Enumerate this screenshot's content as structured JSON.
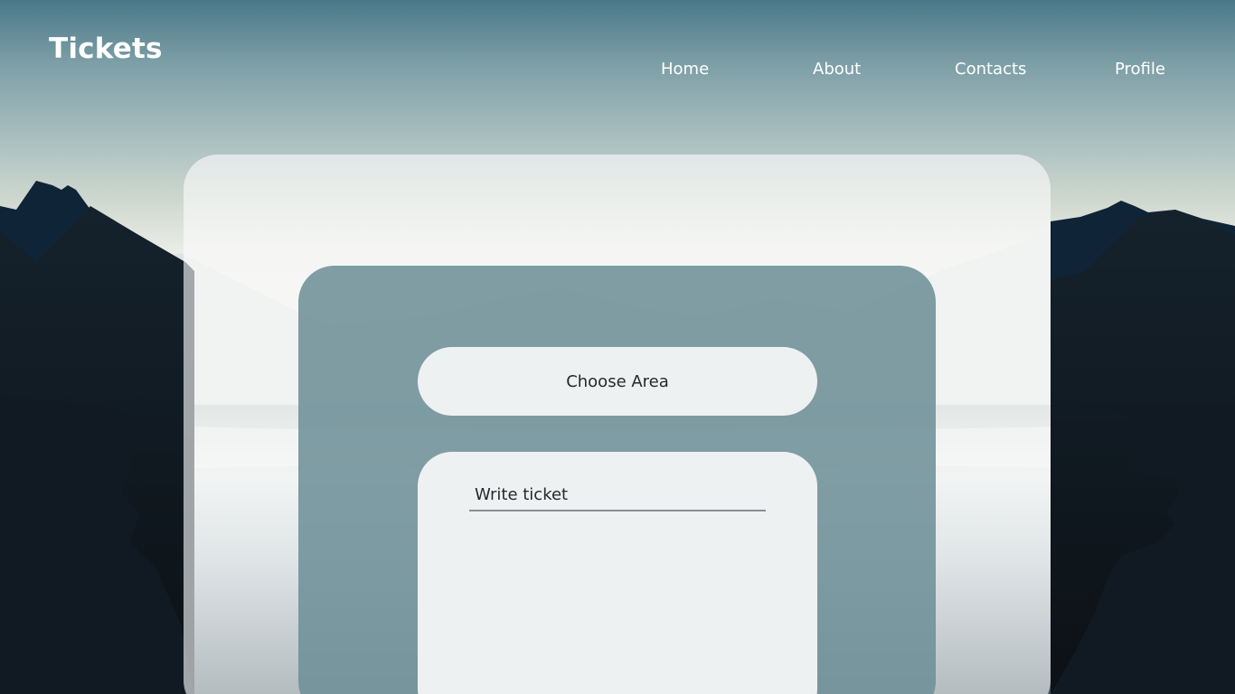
{
  "header": {
    "logo": "Tickets",
    "nav": [
      {
        "label": "Home"
      },
      {
        "label": "About"
      },
      {
        "label": "Contacts"
      },
      {
        "label": "Profile"
      }
    ]
  },
  "form": {
    "area_button_label": "Choose Area",
    "ticket_placeholder": "Write ticket"
  },
  "colors": {
    "sky_top": "#4a7888",
    "mountain_dark": "#121c25",
    "mountain_blue": "#0f2436",
    "inner_card": "#6c8e96",
    "field_bg": "#eef1f2"
  }
}
